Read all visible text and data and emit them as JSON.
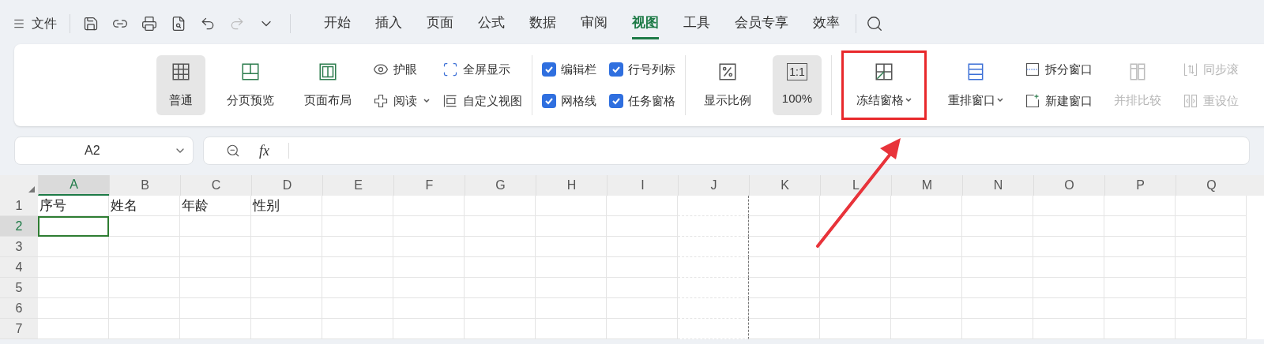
{
  "menu": {
    "file_label": "文件",
    "quick_tools": [
      {
        "disabled": false
      },
      {
        "disabled": false
      },
      {
        "disabled": false
      },
      {
        "disabled": false
      },
      {
        "disabled": false
      },
      {
        "disabled": true
      },
      {
        "disabled": false
      }
    ],
    "tabs": [
      {
        "label": "开始",
        "selected": false
      },
      {
        "label": "插入",
        "selected": false
      },
      {
        "label": "页面",
        "selected": false
      },
      {
        "label": "公式",
        "selected": false
      },
      {
        "label": "数据",
        "selected": false
      },
      {
        "label": "审阅",
        "selected": false
      },
      {
        "label": "视图",
        "selected": true
      },
      {
        "label": "工具",
        "selected": false
      },
      {
        "label": "会员专享",
        "selected": false
      },
      {
        "label": "效率",
        "selected": false
      }
    ]
  },
  "ribbon": {
    "groups": [
      {
        "columns": [
          {
            "kind": "large",
            "items": [
              {
                "label": "普通",
                "selected": true,
                "dropdown": false,
                "highlighted": false,
                "disabled": false
              }
            ]
          },
          {
            "kind": "large",
            "items": [
              {
                "label": "分页预览",
                "selected": false,
                "dropdown": false,
                "highlighted": false,
                "disabled": false
              }
            ]
          },
          {
            "kind": "large",
            "items": [
              {
                "label": "页面布局",
                "selected": false,
                "dropdown": false,
                "highlighted": false,
                "disabled": false
              }
            ]
          },
          {
            "kind": "stack",
            "items": [
              {
                "label": "护眼",
                "dropdown": false,
                "disabled": false
              },
              {
                "label": "阅读",
                "dropdown": true,
                "disabled": false
              }
            ]
          },
          {
            "kind": "stack",
            "items": [
              {
                "label": "全屏显示",
                "dropdown": false,
                "disabled": false
              },
              {
                "label": "自定义视图",
                "dropdown": false,
                "disabled": false
              }
            ]
          }
        ]
      },
      {
        "columns": [
          {
            "kind": "checks",
            "items": [
              {
                "label": "编辑栏",
                "checked": true
              },
              {
                "label": "网格线",
                "checked": true
              }
            ]
          },
          {
            "kind": "checks",
            "items": [
              {
                "label": "行号列标",
                "checked": true
              },
              {
                "label": "任务窗格",
                "checked": true
              }
            ]
          }
        ]
      },
      {
        "columns": [
          {
            "kind": "large",
            "items": [
              {
                "label": "显示比例",
                "selected": false,
                "dropdown": false,
                "highlighted": false,
                "disabled": false
              }
            ]
          },
          {
            "kind": "large",
            "items": [
              {
                "label": "100%",
                "icon_text": "1:1",
                "selected": true,
                "dropdown": false,
                "highlighted": false,
                "disabled": false
              }
            ]
          }
        ]
      },
      {
        "columns": [
          {
            "kind": "large",
            "items": [
              {
                "label": "冻结窗格",
                "selected": false,
                "dropdown": true,
                "highlighted": true,
                "disabled": false
              }
            ]
          },
          {
            "kind": "large",
            "items": [
              {
                "label": "重排窗口",
                "selected": false,
                "dropdown": true,
                "highlighted": false,
                "disabled": false
              }
            ]
          },
          {
            "kind": "stack",
            "items": [
              {
                "label": "拆分窗口",
                "dropdown": false,
                "disabled": false
              },
              {
                "label": "新建窗口",
                "dropdown": false,
                "disabled": false
              }
            ]
          },
          {
            "kind": "large",
            "items": [
              {
                "label": "并排比较",
                "selected": false,
                "dropdown": false,
                "highlighted": false,
                "disabled": true
              }
            ]
          },
          {
            "kind": "stack",
            "items": [
              {
                "label": "同步滚",
                "dropdown": false,
                "disabled": true
              },
              {
                "label": "重设位",
                "dropdown": false,
                "disabled": true
              }
            ]
          }
        ]
      }
    ]
  },
  "formula_bar": {
    "name_box": "A2",
    "fx": "fx"
  },
  "sheet": {
    "columns": [
      {
        "label": "A",
        "selected": true,
        "page_break": false
      },
      {
        "label": "B",
        "selected": false,
        "page_break": false
      },
      {
        "label": "C",
        "selected": false,
        "page_break": false
      },
      {
        "label": "D",
        "selected": false,
        "page_break": false
      },
      {
        "label": "E",
        "selected": false,
        "page_break": false
      },
      {
        "label": "F",
        "selected": false,
        "page_break": false
      },
      {
        "label": "G",
        "selected": false,
        "page_break": false
      },
      {
        "label": "H",
        "selected": false,
        "page_break": false
      },
      {
        "label": "I",
        "selected": false,
        "page_break": false
      },
      {
        "label": "J",
        "selected": false,
        "page_break": true
      },
      {
        "label": "K",
        "selected": false,
        "page_break": false
      },
      {
        "label": "L",
        "selected": false,
        "page_break": false
      },
      {
        "label": "M",
        "selected": false,
        "page_break": false
      },
      {
        "label": "N",
        "selected": false,
        "page_break": false
      },
      {
        "label": "O",
        "selected": false,
        "page_break": false
      },
      {
        "label": "P",
        "selected": false,
        "page_break": false
      },
      {
        "label": "Q",
        "selected": false,
        "page_break": false
      }
    ],
    "rows": [
      {
        "label": "1",
        "selected": false,
        "cells": [
          "序号",
          "姓名",
          "年龄",
          "性别"
        ]
      },
      {
        "label": "2",
        "selected": true,
        "cells": []
      },
      {
        "label": "3",
        "selected": false,
        "cells": []
      },
      {
        "label": "4",
        "selected": false,
        "cells": []
      },
      {
        "label": "5",
        "selected": false,
        "cells": []
      },
      {
        "label": "6",
        "selected": false,
        "cells": []
      },
      {
        "label": "7",
        "selected": false,
        "cells": []
      }
    ]
  }
}
